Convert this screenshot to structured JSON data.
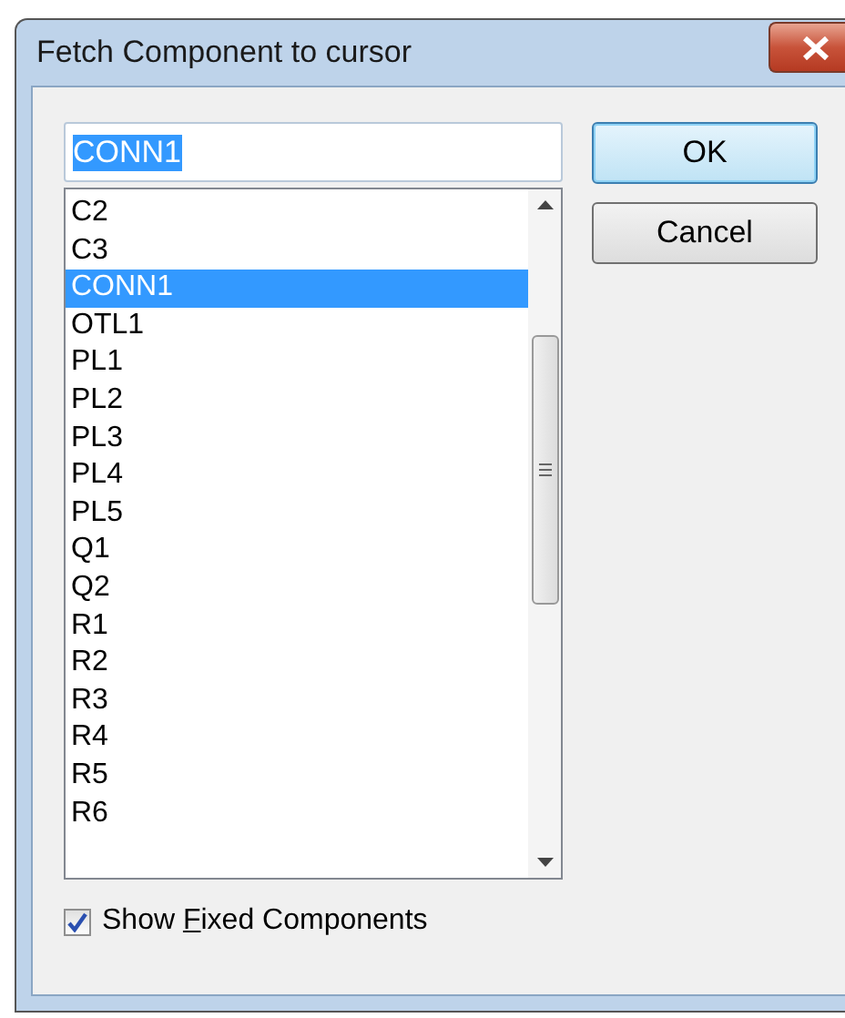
{
  "window": {
    "title": "Fetch Component to cursor"
  },
  "name_field": {
    "value": "CONN1",
    "text_selected": true
  },
  "components": [
    {
      "label": "C2",
      "selected": false
    },
    {
      "label": "C3",
      "selected": false
    },
    {
      "label": "CONN1",
      "selected": true
    },
    {
      "label": "OTL1",
      "selected": false
    },
    {
      "label": "PL1",
      "selected": false
    },
    {
      "label": "PL2",
      "selected": false
    },
    {
      "label": "PL3",
      "selected": false
    },
    {
      "label": "PL4",
      "selected": false
    },
    {
      "label": "PL5",
      "selected": false
    },
    {
      "label": "Q1",
      "selected": false
    },
    {
      "label": "Q2",
      "selected": false
    },
    {
      "label": "R1",
      "selected": false
    },
    {
      "label": "R2",
      "selected": false
    },
    {
      "label": "R3",
      "selected": false
    },
    {
      "label": "R4",
      "selected": false
    },
    {
      "label": "R5",
      "selected": false
    },
    {
      "label": "R6",
      "selected": false
    }
  ],
  "buttons": [
    {
      "label": "OK",
      "default": true
    },
    {
      "label": "Cancel",
      "default": false
    }
  ],
  "show_fixed": {
    "label_parts": [
      {
        "text": "Show ",
        "access_key": false
      },
      {
        "text": "F",
        "access_key": true
      },
      {
        "text": "ixed Components",
        "access_key": false
      }
    ],
    "checked": true
  }
}
